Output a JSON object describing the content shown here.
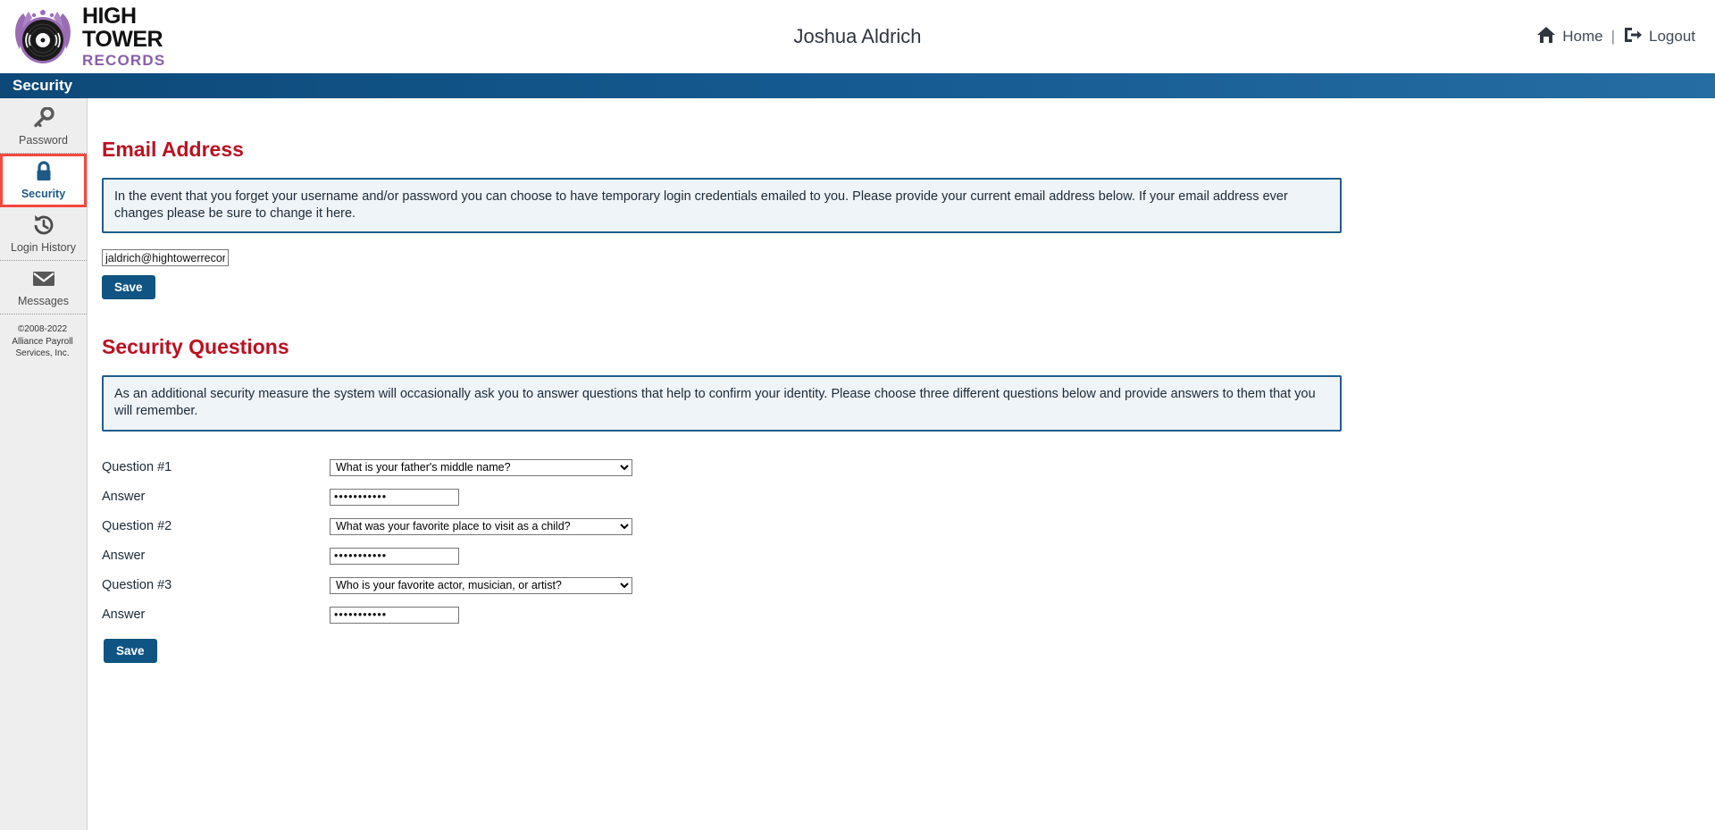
{
  "header": {
    "logo": {
      "line1": "HIGH",
      "line2": "TOWER",
      "line3": "RECORDS",
      "icon": "vinyl-record-logo"
    },
    "user_name": "Joshua Aldrich",
    "home_label": "Home",
    "separator": "|",
    "logout_label": "Logout",
    "home_icon": "home-icon",
    "logout_icon": "logout-icon"
  },
  "title_bar": {
    "title": "Security"
  },
  "sidebar": {
    "items": [
      {
        "label": "Password",
        "icon": "key-icon",
        "active": false
      },
      {
        "label": "Security",
        "icon": "lock-icon",
        "active": true
      },
      {
        "label": "Login History",
        "icon": "history-icon",
        "active": false
      },
      {
        "label": "Messages",
        "icon": "envelope-icon",
        "active": false
      }
    ],
    "copyright": "©2008-2022 Alliance Payroll Services, Inc."
  },
  "email_section": {
    "heading": "Email Address",
    "info": "In the event that you forget your username and/or password you can choose to have temporary login credentials emailed to you.   Please provide your current email address below.  If your email address ever changes please be sure to change it here.",
    "email_value": "jaldrich@hightowerrecords.c",
    "email_placeholder": "",
    "save_label": "Save"
  },
  "questions_section": {
    "heading": "Security Questions",
    "info": "As an additional security measure the system will occasionally ask you to answer questions that help to confirm your identity.  Please choose three different questions below and provide answers to them that you will remember.",
    "rows": [
      {
        "question_label": "Question #1",
        "question_value": "What is your father's middle name?",
        "answer_label": "Answer",
        "answer_value": "•••••••••••"
      },
      {
        "question_label": "Question #2",
        "question_value": "What was your favorite place to visit as a child?",
        "answer_label": "Answer",
        "answer_value": "•••••••••••"
      },
      {
        "question_label": "Question #3",
        "question_value": "Who is your favorite actor, musician, or artist?",
        "answer_label": "Answer",
        "answer_value": "•••••••••••"
      }
    ],
    "save_label": "Save"
  },
  "colors": {
    "accent_blue": "#0f5482",
    "title_bar_blue": "#14598f",
    "heading_red": "#bb1122",
    "active_outline_red": "#f4483f",
    "logo_purple": "#8b5ea8",
    "info_box_bg": "#eff4f8"
  }
}
